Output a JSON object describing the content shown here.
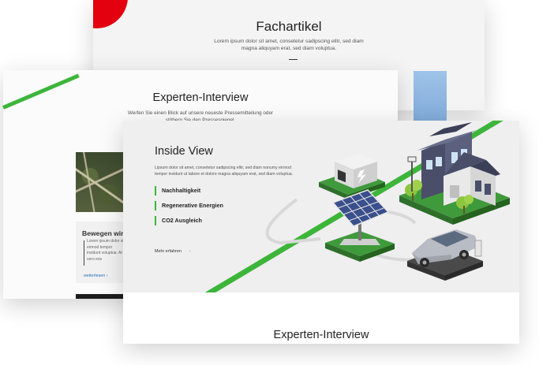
{
  "back_card": {
    "title": "Fachartikel",
    "text": "Lorem ipsum dolor sit amet, consetetur sadipscing elitr, sed diam magna aliquyam erat, sed diam voluptua."
  },
  "middle_card": {
    "title": "Experten-Interview",
    "subtitle": "Werfen Sie einen Blick auf unsere neueste Pressemitteilung oder stöbern Sie den Pressespiegel.",
    "teaser": {
      "title": "Bewegen wir u",
      "text": "Lorem ipsum dolor sit eirmod tempor invidunt voluptua. At vero eos",
      "link": "weiterlesen"
    }
  },
  "front_card": {
    "title": "Inside View",
    "intro": "Lipsum dolor sit amet, consetetur sadipscing elitr, sed diam nonumy eirmod tempor invidunt ut labore et dolore magna aliquyam erat, sed diam voluptua.",
    "features": [
      "Nachhaltigkeit",
      "Regenerative Energien",
      "CO2 Ausgleich"
    ],
    "more_link": "Mehr erfahren",
    "bottom_title": "Experten-Interview"
  },
  "colors": {
    "accent_green": "#3db53a",
    "brand_red": "#e3000f",
    "house_dark": "#4a4e69",
    "grass": "#3f9a3c"
  },
  "icons": {
    "chevron": "chevron-right-icon"
  }
}
